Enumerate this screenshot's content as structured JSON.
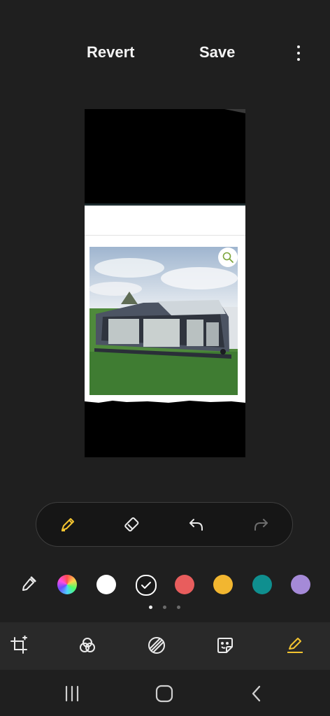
{
  "top_bar": {
    "revert_label": "Revert",
    "save_label": "Save",
    "more_icon": "more-vertical-icon"
  },
  "pen_toolbar": {
    "tools": [
      "pen-icon",
      "eraser-icon",
      "undo-icon",
      "redo-icon"
    ],
    "active_color": "#f4c430"
  },
  "palette": {
    "colors": [
      "#ffffff",
      "#1a1a1a",
      "#e85d5d",
      "#f2b630",
      "#0f8f8f",
      "#a58ad8"
    ],
    "selected_index": 1
  },
  "page_indicator": {
    "pages": 3,
    "current": 1
  },
  "bottom_tools": [
    "crop-rotate-icon",
    "filters-icon",
    "adjust-icon",
    "sticker-icon",
    "draw-icon"
  ],
  "nav": [
    "recent-apps-icon",
    "home-icon",
    "back-icon"
  ]
}
